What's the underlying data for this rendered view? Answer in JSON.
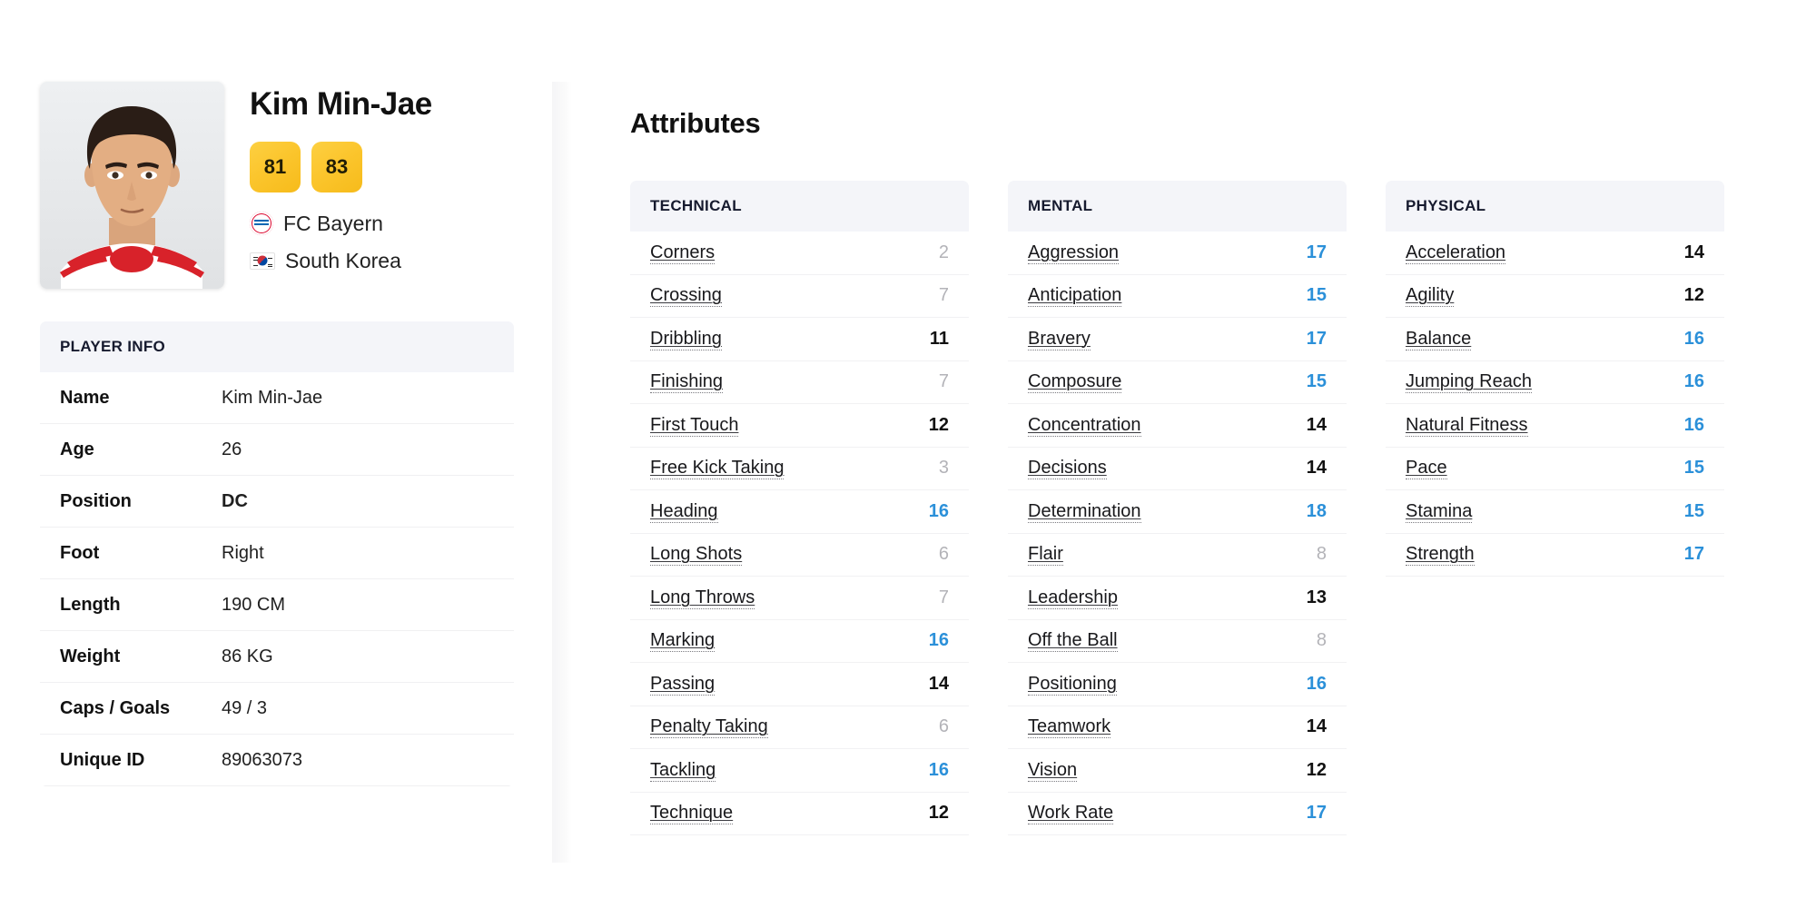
{
  "player": {
    "name": "Kim Min-Jae",
    "ratings": [
      {
        "label": "81",
        "kind": "current-ability"
      },
      {
        "label": "83",
        "kind": "potential-ability"
      }
    ],
    "club": "FC Bayern",
    "club_icon": "fc-bayern-crest-icon",
    "nation": "South Korea",
    "nation_icon": "south-korea-flag-icon",
    "portrait_icon": "player-portrait"
  },
  "player_info": {
    "header": "PLAYER INFO",
    "rows": [
      {
        "label": "Name",
        "value": "Kim Min-Jae",
        "bold": false
      },
      {
        "label": "Age",
        "value": "26",
        "bold": false
      },
      {
        "label": "Position",
        "value": "DC",
        "bold": true
      },
      {
        "label": "Foot",
        "value": "Right",
        "bold": false
      },
      {
        "label": "Length",
        "value": "190 CM",
        "bold": false
      },
      {
        "label": "Weight",
        "value": "86 KG",
        "bold": false
      },
      {
        "label": "Caps / Goals",
        "value": "49 / 3",
        "bold": false
      },
      {
        "label": "Unique ID",
        "value": "89063073",
        "bold": false
      }
    ]
  },
  "attributes": {
    "title": "Attributes",
    "value_colors": {
      "low": "#b3b3b8",
      "mid": "#111111",
      "high": "#2b90d9"
    },
    "columns": [
      {
        "header": "TECHNICAL",
        "rows": [
          {
            "name": "Corners",
            "value": "2",
            "tier": "low"
          },
          {
            "name": "Crossing",
            "value": "7",
            "tier": "low"
          },
          {
            "name": "Dribbling",
            "value": "11",
            "tier": "mid"
          },
          {
            "name": "Finishing",
            "value": "7",
            "tier": "low"
          },
          {
            "name": "First Touch",
            "value": "12",
            "tier": "mid"
          },
          {
            "name": "Free Kick Taking",
            "value": "3",
            "tier": "low"
          },
          {
            "name": "Heading",
            "value": "16",
            "tier": "high"
          },
          {
            "name": "Long Shots",
            "value": "6",
            "tier": "low"
          },
          {
            "name": "Long Throws",
            "value": "7",
            "tier": "low"
          },
          {
            "name": "Marking",
            "value": "16",
            "tier": "high"
          },
          {
            "name": "Passing",
            "value": "14",
            "tier": "mid"
          },
          {
            "name": "Penalty Taking",
            "value": "6",
            "tier": "low"
          },
          {
            "name": "Tackling",
            "value": "16",
            "tier": "high"
          },
          {
            "name": "Technique",
            "value": "12",
            "tier": "mid"
          }
        ]
      },
      {
        "header": "MENTAL",
        "rows": [
          {
            "name": "Aggression",
            "value": "17",
            "tier": "high"
          },
          {
            "name": "Anticipation",
            "value": "15",
            "tier": "high"
          },
          {
            "name": "Bravery",
            "value": "17",
            "tier": "high"
          },
          {
            "name": "Composure",
            "value": "15",
            "tier": "high"
          },
          {
            "name": "Concentration",
            "value": "14",
            "tier": "mid"
          },
          {
            "name": "Decisions",
            "value": "14",
            "tier": "mid"
          },
          {
            "name": "Determination",
            "value": "18",
            "tier": "high"
          },
          {
            "name": "Flair",
            "value": "8",
            "tier": "low"
          },
          {
            "name": "Leadership",
            "value": "13",
            "tier": "mid"
          },
          {
            "name": "Off the Ball",
            "value": "8",
            "tier": "low"
          },
          {
            "name": "Positioning",
            "value": "16",
            "tier": "high"
          },
          {
            "name": "Teamwork",
            "value": "14",
            "tier": "mid"
          },
          {
            "name": "Vision",
            "value": "12",
            "tier": "mid"
          },
          {
            "name": "Work Rate",
            "value": "17",
            "tier": "high"
          }
        ]
      },
      {
        "header": "PHYSICAL",
        "rows": [
          {
            "name": "Acceleration",
            "value": "14",
            "tier": "mid"
          },
          {
            "name": "Agility",
            "value": "12",
            "tier": "mid"
          },
          {
            "name": "Balance",
            "value": "16",
            "tier": "high"
          },
          {
            "name": "Jumping Reach",
            "value": "16",
            "tier": "high"
          },
          {
            "name": "Natural Fitness",
            "value": "16",
            "tier": "high"
          },
          {
            "name": "Pace",
            "value": "15",
            "tier": "high"
          },
          {
            "name": "Stamina",
            "value": "15",
            "tier": "high"
          },
          {
            "name": "Strength",
            "value": "17",
            "tier": "high"
          }
        ]
      }
    ]
  }
}
